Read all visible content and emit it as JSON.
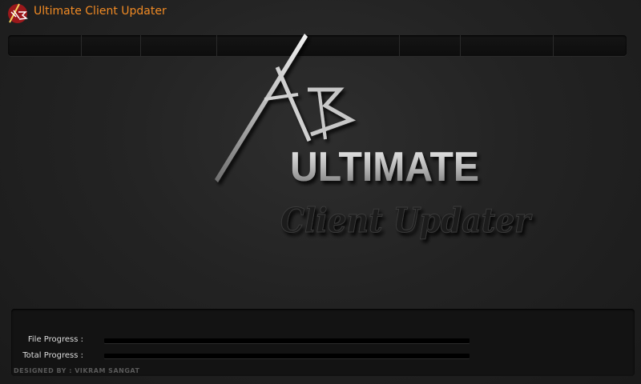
{
  "window": {
    "title": "Ultimate Client Updater",
    "icon": "ab-logo-icon"
  },
  "logo": {
    "mark": "AB",
    "word1": "ULTIMATE",
    "word2": "Client Updater"
  },
  "progress": {
    "file_label": "File Progress :",
    "file_value": 0,
    "total_label": "Total Progress :",
    "total_value": 0
  },
  "footer": {
    "credit": "DESIGNED BY : VIKRAM SANGAT"
  },
  "colors": {
    "accent": "#f08a24",
    "panel": "#131313",
    "background": "#262626"
  }
}
